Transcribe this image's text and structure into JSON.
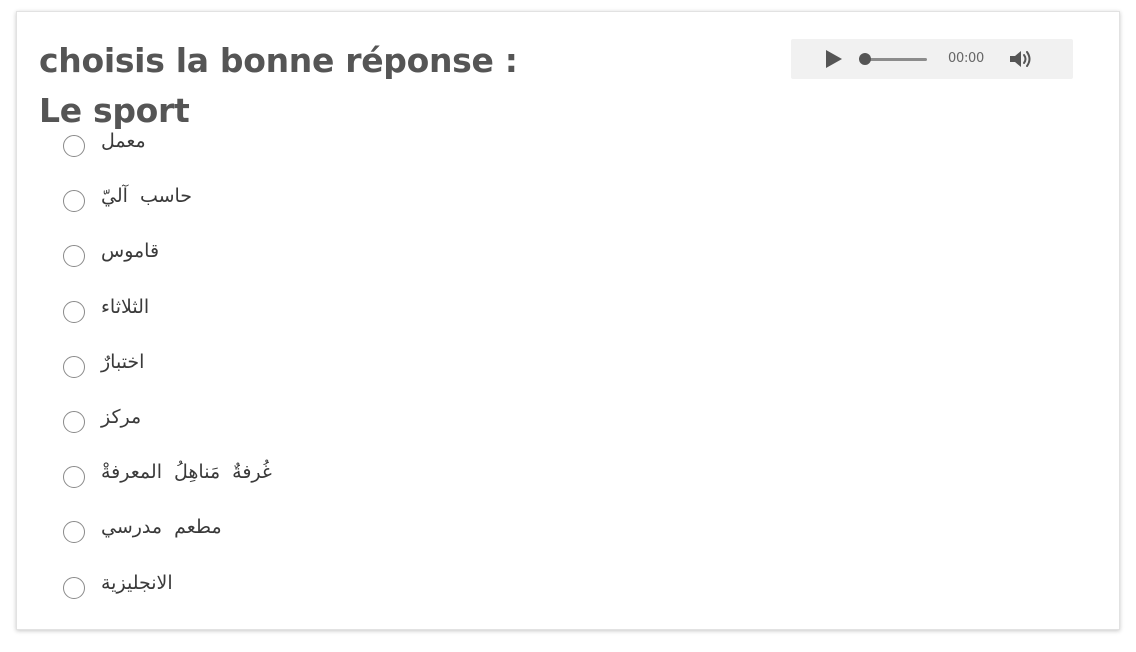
{
  "question": {
    "line1": "choisis la bonne réponse :",
    "line2": "Le sport"
  },
  "audio": {
    "time": "00:00",
    "icons": {
      "play": "play-icon",
      "volume": "volume-icon"
    }
  },
  "options": [
    {
      "label": "معمل"
    },
    {
      "label": "حاسب  آليّ"
    },
    {
      "label": "قاموس"
    },
    {
      "label": "الثلاثاء"
    },
    {
      "label": "اختبارٌ"
    },
    {
      "label": "مركز"
    },
    {
      "label": "غُرفةٌ  مَناهِلُ المعرفةْ"
    },
    {
      "label": "مطعم  مدرسي"
    },
    {
      "label": "الانجليزية"
    }
  ],
  "colors": {
    "title": "#555555",
    "text": "#3a3a3a",
    "audio_bg": "#f1f1f1",
    "radio_border": "#8a8a8a"
  }
}
